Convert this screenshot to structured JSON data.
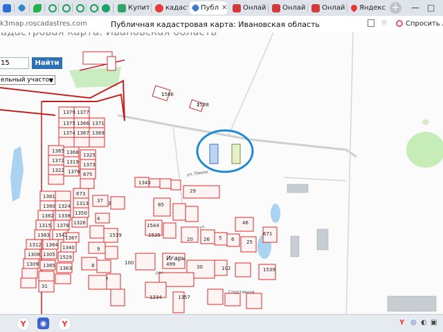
{
  "browser": {
    "tabs": [
      {
        "label": "",
        "icon": "document-icon",
        "color": "#2b6fd6"
      },
      {
        "label": "",
        "icon": "kadastr-icon",
        "color": "#2f86c9"
      },
      {
        "label": "",
        "icon": "green-leaf-icon",
        "color": "#23b14d"
      },
      {
        "label": "",
        "icon": "circle-arrow-icon",
        "color": "#1c9b52"
      },
      {
        "label": "",
        "icon": "circle-arrow-icon",
        "color": "#1c9b52"
      },
      {
        "label": "",
        "icon": "circle-arrow-icon",
        "color": "#1c9b52"
      },
      {
        "label": "",
        "icon": "circle-arrow-icon",
        "color": "#1c9b52"
      },
      {
        "label": "",
        "icon": "green-b-icon",
        "color": "#1c9b52"
      },
      {
        "label": "",
        "icon": "shopping-icon",
        "color": "#1aa364"
      },
      {
        "label": "Купить",
        "icon": "map-apps-icon",
        "color": "#2fa36b"
      },
      {
        "label": "кадастр",
        "icon": "yandex-icon",
        "color": "#e23c3c"
      },
      {
        "label": "Публ",
        "icon": "pin-icon",
        "color": "#3a7bd5",
        "active": true
      },
      {
        "label": "Онлайн",
        "icon": "red-square-icon",
        "color": "#d33a3a"
      },
      {
        "label": "Онлайн",
        "icon": "red-square-icon",
        "color": "#d33a3a"
      },
      {
        "label": "Онлайн",
        "icon": "red-square-icon",
        "color": "#d33a3a"
      },
      {
        "label": "Яндекс",
        "icon": "map-pin-icon",
        "color": "#e33"
      }
    ],
    "new_tab": "+",
    "url": "k3map.roscadastres.com",
    "page_title": "Публичная кадастровая карта: Ивановская область",
    "ask_label": "Спросить А"
  },
  "map": {
    "bg_title": "кадастровая карта: Ивановская область",
    "search_value": "15",
    "find_label": "Найти",
    "object_type": "ельный участок",
    "village_label": "Игарь",
    "parcel_numbers": [
      "2",
      "1",
      "1379",
      "1377",
      "1375",
      "1366",
      "1371",
      "1374",
      "1367",
      "1369",
      "1365",
      "1368",
      "1325",
      "1372",
      "1319",
      "1373",
      "1322",
      "1376",
      "675",
      "1343",
      "37",
      "1381",
      "673",
      "1380",
      "1324",
      "1313",
      "1382",
      "1338",
      "1350",
      "1315",
      "1378",
      "1326",
      "1383",
      "1542",
      "1387",
      "1312",
      "1384",
      "1340",
      "1308",
      "1305",
      "1529",
      "1309",
      "1385",
      "1363",
      "499",
      "100",
      "1234",
      "1357",
      "29",
      "46",
      "85",
      "1535",
      "20",
      "26",
      "25",
      "30",
      "102",
      "671",
      "1519",
      "9",
      "8",
      "7",
      "5",
      "6",
      "3",
      "4",
      "31",
      "1544",
      "1539",
      "1538",
      "1586"
    ],
    "highlight_color": "#1b88d4",
    "parcel_color": "#d42828"
  },
  "taskbar": {
    "items": [
      "yandex-icon",
      "screen-record-icon",
      "yandex-browser-icon"
    ],
    "tray": [
      "Y",
      "wifi-icon",
      "volume-icon",
      "network-icon"
    ]
  }
}
